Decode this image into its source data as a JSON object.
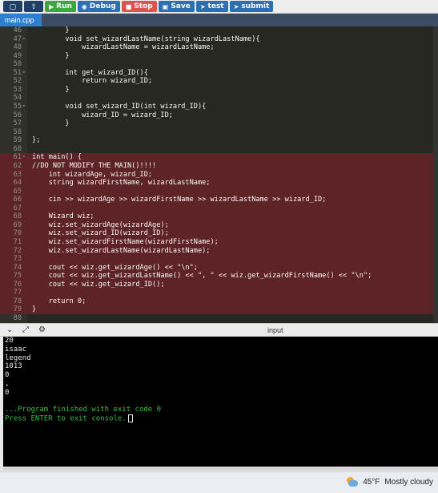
{
  "toolbar": {
    "run": "Run",
    "debug": "Debug",
    "stop": "Stop",
    "save": "Save",
    "test": "test",
    "submit": "submit"
  },
  "tab": {
    "name": "main.cpp"
  },
  "code_lines": [
    {
      "n": "46",
      "t": "        }",
      "hl": false
    },
    {
      "n": "47",
      "t": "        void set_wizardLastName(string wizardLastName){",
      "hl": false
    },
    {
      "n": "48",
      "t": "            wizardLastName = wizardLastName;",
      "hl": false
    },
    {
      "n": "49",
      "t": "        }",
      "hl": false
    },
    {
      "n": "50",
      "t": "",
      "hl": false
    },
    {
      "n": "51",
      "t": "        int get_wizard_ID(){",
      "hl": false
    },
    {
      "n": "52",
      "t": "            return wizard_ID;",
      "hl": false
    },
    {
      "n": "53",
      "t": "        }",
      "hl": false
    },
    {
      "n": "54",
      "t": "",
      "hl": false
    },
    {
      "n": "55",
      "t": "        void set_wizard_ID(int wizard_ID){",
      "hl": false
    },
    {
      "n": "56",
      "t": "            wizard_ID = wizard_ID;",
      "hl": false
    },
    {
      "n": "57",
      "t": "        }",
      "hl": false
    },
    {
      "n": "58",
      "t": "",
      "hl": false
    },
    {
      "n": "59",
      "t": "};",
      "hl": false
    },
    {
      "n": "60",
      "t": "",
      "hl": false
    },
    {
      "n": "61",
      "t": "int main() {",
      "hl": true
    },
    {
      "n": "62",
      "t": "//DO NOT MODIFY THE MAIN()!!!!",
      "hl": true
    },
    {
      "n": "63",
      "t": "    int wizardAge, wizard_ID;",
      "hl": true
    },
    {
      "n": "64",
      "t": "    string wizardFirstName, wizardLastName;",
      "hl": true
    },
    {
      "n": "65",
      "t": "",
      "hl": true
    },
    {
      "n": "66",
      "t": "    cin >> wizardAge >> wizardFirstName >> wizardLastName >> wizard_ID;",
      "hl": true
    },
    {
      "n": "67",
      "t": "",
      "hl": true
    },
    {
      "n": "68",
      "t": "    Wizard wiz;",
      "hl": true
    },
    {
      "n": "69",
      "t": "    wiz.set_wizardAge(wizardAge);",
      "hl": true
    },
    {
      "n": "70",
      "t": "    wiz.set_wizard_ID(wizard_ID);",
      "hl": true
    },
    {
      "n": "71",
      "t": "    wiz.set_wizardFirstName(wizardFirstName);",
      "hl": true
    },
    {
      "n": "72",
      "t": "    wiz.set_wizardLastName(wizardLastName);",
      "hl": true
    },
    {
      "n": "73",
      "t": "",
      "hl": true
    },
    {
      "n": "74",
      "t": "    cout << wiz.get_wizardAge() << \"\\n\";",
      "hl": true
    },
    {
      "n": "75",
      "t": "    cout << wiz.get_wizardLastName() << \", \" << wiz.get_wizardFirstName() << \"\\n\";",
      "hl": true
    },
    {
      "n": "76",
      "t": "    cout << wiz.get_wizard_ID();",
      "hl": true
    },
    {
      "n": "77",
      "t": "",
      "hl": true
    },
    {
      "n": "78",
      "t": "    return 0;",
      "hl": true
    },
    {
      "n": "79",
      "t": "}",
      "hl": true
    },
    {
      "n": "80",
      "t": "",
      "hl": false
    }
  ],
  "console_header": {
    "input_label": "input"
  },
  "console_lines": [
    {
      "t": "20",
      "green": false
    },
    {
      "t": "isaac",
      "green": false
    },
    {
      "t": "legend",
      "green": false
    },
    {
      "t": "1013",
      "green": false
    },
    {
      "t": "0",
      "green": false
    },
    {
      "t": ",",
      "green": false
    },
    {
      "t": "0",
      "green": false
    },
    {
      "t": "",
      "green": false
    },
    {
      "t": "...Program finished with exit code 0",
      "green": true
    },
    {
      "t": "Press ENTER to exit console.",
      "green": true
    }
  ],
  "taskbar": {
    "temperature": "45°F",
    "condition": "Mostly cloudy"
  },
  "colors": {
    "run": "#3aa83e",
    "stop": "#d9534f",
    "primary": "#2c6fb3",
    "highlight": "#5e2326"
  }
}
